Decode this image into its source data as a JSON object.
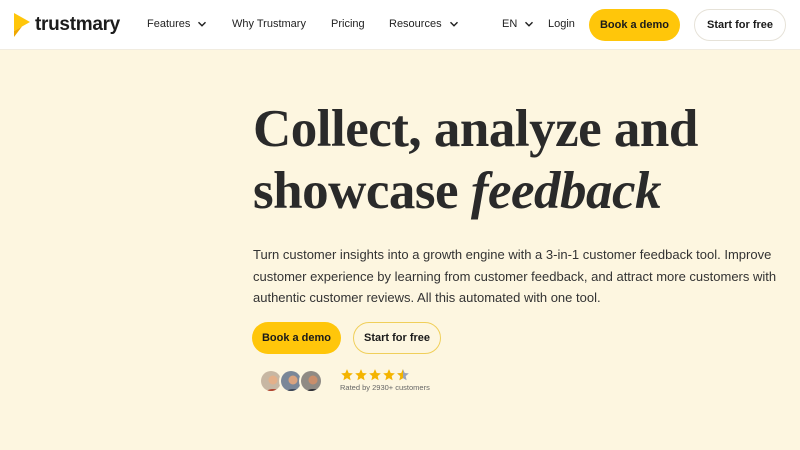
{
  "header": {
    "brand": "trustmary",
    "nav": [
      {
        "label": "Features",
        "has_dropdown": true
      },
      {
        "label": "Why Trustmary",
        "has_dropdown": false
      },
      {
        "label": "Pricing",
        "has_dropdown": false
      },
      {
        "label": "Resources",
        "has_dropdown": true
      }
    ],
    "language": "EN",
    "login": "Login",
    "book_demo": "Book a demo",
    "start_free": "Start for free"
  },
  "hero": {
    "title_line1": "Collect, analyze and",
    "title_line2_plain": "showcase",
    "title_line2_italic": "feedback",
    "subtitle": "Turn customer insights into a growth engine with a 3-in-1 customer feedback tool. Improve customer experience by learning from customer feedback, and attract more customers with authentic customer reviews. All this automated with one tool.",
    "book_demo": "Book a demo",
    "start_free": "Start for free",
    "rating": {
      "stars": 4.5,
      "max": 5,
      "text": "Rated by 2930+ customers"
    }
  },
  "colors": {
    "background": "#fdf6e0",
    "accent_yellow": "#ffc60a",
    "star_gold": "#f4b400",
    "star_empty": "#9aa3b8"
  }
}
